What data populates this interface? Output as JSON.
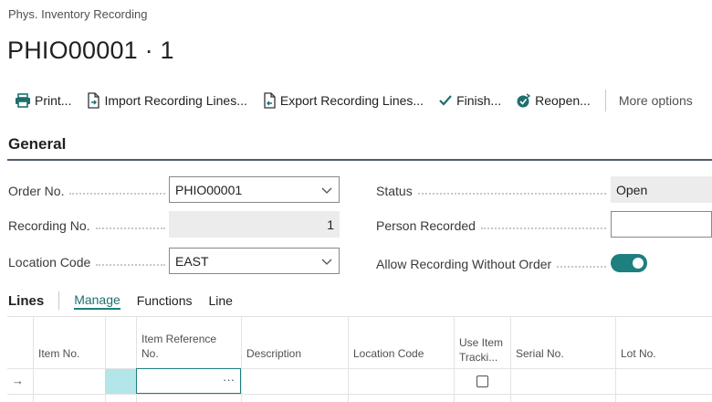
{
  "page": {
    "breadcrumb": "Phys. Inventory Recording",
    "title": "PHIO00001 · 1"
  },
  "actions": {
    "print": "Print...",
    "import": "Import Recording Lines...",
    "export": "Export Recording Lines...",
    "finish": "Finish...",
    "reopen": "Reopen...",
    "more": "More options"
  },
  "general": {
    "section_title": "General",
    "order_no_label": "Order No.",
    "order_no_value": "PHIO00001",
    "recording_no_label": "Recording No.",
    "recording_no_value": "1",
    "location_code_label": "Location Code",
    "location_code_value": "EAST",
    "status_label": "Status",
    "status_value": "Open",
    "person_recorded_label": "Person Recorded",
    "person_recorded_value": "",
    "allow_recording_label": "Allow Recording Without Order",
    "allow_recording_on": true
  },
  "lines": {
    "title": "Lines",
    "tabs": [
      "Manage",
      "Functions",
      "Line"
    ],
    "columns": {
      "item_no": "Item No.",
      "item_reference_no": "Item Reference No.",
      "description": "Description",
      "location_code": "Location Code",
      "use_item_tracking": "Use Item Tracki...",
      "serial_no": "Serial No.",
      "lot_no": "Lot No."
    },
    "row_arrow": "→",
    "cell_ellipsis": "···"
  },
  "colors": {
    "accent": "#1e7f7f",
    "selected_cell": "#b3e6e8",
    "readonly_bg": "#ececec"
  },
  "icons": {
    "print": "printer-icon",
    "import": "import-doc-icon",
    "export": "export-doc-icon",
    "finish": "checkmark-icon",
    "reopen": "reopen-icon",
    "dropdown": "chevron-down-icon"
  }
}
